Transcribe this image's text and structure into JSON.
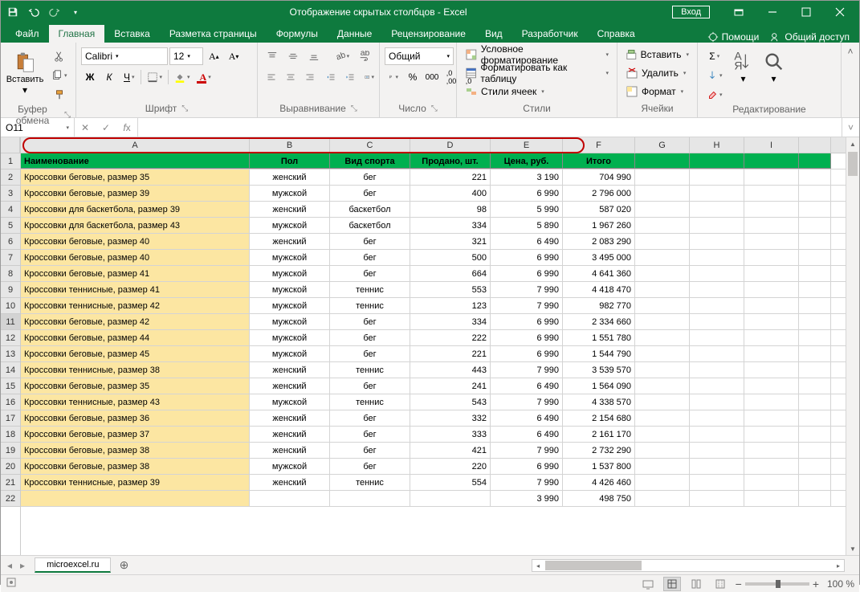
{
  "title": "Отображение скрытых столбцов  -  Excel",
  "signin": "Вход",
  "tabs": [
    "Файл",
    "Главная",
    "Вставка",
    "Разметка страницы",
    "Формулы",
    "Данные",
    "Рецензирование",
    "Вид",
    "Разработчик",
    "Справка"
  ],
  "help": "Помощи",
  "share": "Общий доступ",
  "groups": {
    "clipboard": "Буфер обмена",
    "font": "Шрифт",
    "align": "Выравнивание",
    "number": "Число",
    "styles": "Стили",
    "cells": "Ячейки",
    "editing": "Редактирование"
  },
  "paste": "Вставить",
  "font": "Calibri",
  "fontsize": "12",
  "numberformat": "Общий",
  "insert": "Вставить",
  "delete": "Удалить",
  "format": "Формат",
  "condfmt": "Условное форматирование",
  "fmttable": "Форматировать как таблицу",
  "cellstyles": "Стили ячеек",
  "namebox": "O11",
  "colwidths": {
    "A": 285,
    "B": 100,
    "C": 100,
    "D": 100,
    "E": 90,
    "F": 90,
    "G": 68,
    "H": 68,
    "I": 68,
    "J": 40
  },
  "cols": [
    "A",
    "B",
    "C",
    "D",
    "E",
    "F",
    "G",
    "H",
    "I",
    ""
  ],
  "header": [
    "Наименование",
    "Пол",
    "Вид спорта",
    "Продано, шт.",
    "Цена, руб.",
    "Итого",
    "",
    "",
    "",
    ""
  ],
  "rows": [
    [
      "Кроссовки беговые, размер 35",
      "женский",
      "бег",
      "221",
      "3 190",
      "704 990"
    ],
    [
      "Кроссовки беговые, размер 39",
      "мужской",
      "бег",
      "400",
      "6 990",
      "2 796 000"
    ],
    [
      "Кроссовки для баскетбола, размер 39",
      "женский",
      "баскетбол",
      "98",
      "5 990",
      "587 020"
    ],
    [
      "Кроссовки для баскетбола, размер 43",
      "мужской",
      "баскетбол",
      "334",
      "5 890",
      "1 967 260"
    ],
    [
      "Кроссовки беговые, размер 40",
      "женский",
      "бег",
      "321",
      "6 490",
      "2 083 290"
    ],
    [
      "Кроссовки беговые, размер 40",
      "мужской",
      "бег",
      "500",
      "6 990",
      "3 495 000"
    ],
    [
      "Кроссовки беговые, размер 41",
      "мужской",
      "бег",
      "664",
      "6 990",
      "4 641 360"
    ],
    [
      "Кроссовки теннисные, размер 41",
      "мужской",
      "теннис",
      "553",
      "7 990",
      "4 418 470"
    ],
    [
      "Кроссовки теннисные, размер 42",
      "мужской",
      "теннис",
      "123",
      "7 990",
      "982 770"
    ],
    [
      "Кроссовки беговые, размер 42",
      "мужской",
      "бег",
      "334",
      "6 990",
      "2 334 660"
    ],
    [
      "Кроссовки беговые, размер 44",
      "мужской",
      "бег",
      "222",
      "6 990",
      "1 551 780"
    ],
    [
      "Кроссовки беговые, размер 45",
      "мужской",
      "бег",
      "221",
      "6 990",
      "1 544 790"
    ],
    [
      "Кроссовки теннисные, размер 38",
      "женский",
      "теннис",
      "443",
      "7 990",
      "3 539 570"
    ],
    [
      "Кроссовки беговые, размер 35",
      "женский",
      "бег",
      "241",
      "6 490",
      "1 564 090"
    ],
    [
      "Кроссовки теннисные, размер 43",
      "мужской",
      "теннис",
      "543",
      "7 990",
      "4 338 570"
    ],
    [
      "Кроссовки беговые, размер 36",
      "женский",
      "бег",
      "332",
      "6 490",
      "2 154 680"
    ],
    [
      "Кроссовки беговые, размер 37",
      "женский",
      "бег",
      "333",
      "6 490",
      "2 161 170"
    ],
    [
      "Кроссовки беговые, размер 38",
      "женский",
      "бег",
      "421",
      "7 990",
      "2 732 290"
    ],
    [
      "Кроссовки беговые, размер 38",
      "мужской",
      "бег",
      "220",
      "6 990",
      "1 537 800"
    ],
    [
      "Кроссовки теннисные, размер 39",
      "женский",
      "теннис",
      "554",
      "7 990",
      "4 426 460"
    ]
  ],
  "partialrow": [
    "",
    "",
    "",
    "",
    "3 990",
    "498 750"
  ],
  "sheet": "microexcel.ru",
  "zoom": "100 %",
  "selected_row": 11
}
